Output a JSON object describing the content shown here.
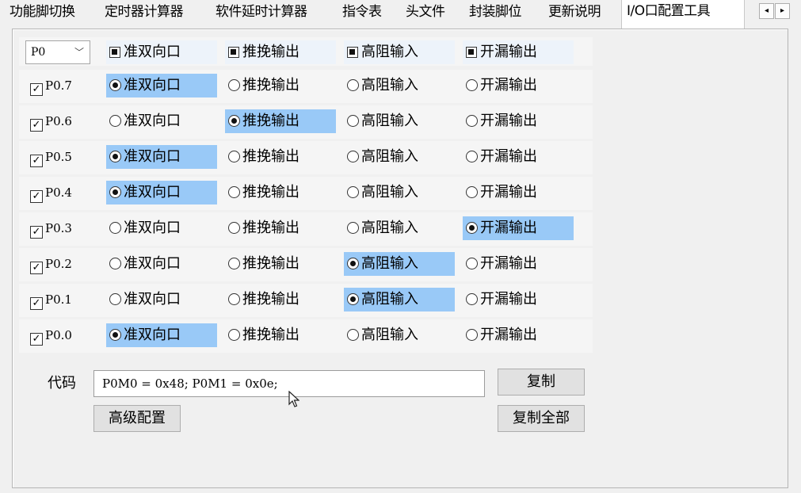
{
  "tabs": [
    {
      "label": "功能脚切换",
      "active": false
    },
    {
      "label": "定时器计算器",
      "active": false
    },
    {
      "label": "软件延时计算器",
      "active": false
    },
    {
      "label": "指令表",
      "active": false
    },
    {
      "label": "头文件",
      "active": false
    },
    {
      "label": "封装脚位",
      "active": false
    },
    {
      "label": "更新说明",
      "active": false
    },
    {
      "label": "I/O口配置工具",
      "active": true
    }
  ],
  "tab_scroll": {
    "left": "◂",
    "right": "▸"
  },
  "port_select": {
    "value": "P0",
    "chevron": "﹀"
  },
  "modes": [
    "准双向口",
    "推挽输出",
    "高阻输入",
    "开漏输出"
  ],
  "pins": [
    {
      "label": "P0.7",
      "checked": true,
      "mode": 0
    },
    {
      "label": "P0.6",
      "checked": true,
      "mode": 1
    },
    {
      "label": "P0.5",
      "checked": true,
      "mode": 0
    },
    {
      "label": "P0.4",
      "checked": true,
      "mode": 0
    },
    {
      "label": "P0.3",
      "checked": true,
      "mode": 3
    },
    {
      "label": "P0.2",
      "checked": true,
      "mode": 2
    },
    {
      "label": "P0.1",
      "checked": true,
      "mode": 2
    },
    {
      "label": "P0.0",
      "checked": true,
      "mode": 0
    }
  ],
  "code": {
    "label": "代码",
    "value": "P0M0 = 0x48; P0M1 = 0x0e;"
  },
  "buttons": {
    "advanced": "高级配置",
    "copy": "复制",
    "copy_all": "复制全部"
  },
  "colors": {
    "selected": "#99c9f7",
    "header_highlight": "#edf3fa",
    "panel": "#f0f0f0"
  }
}
